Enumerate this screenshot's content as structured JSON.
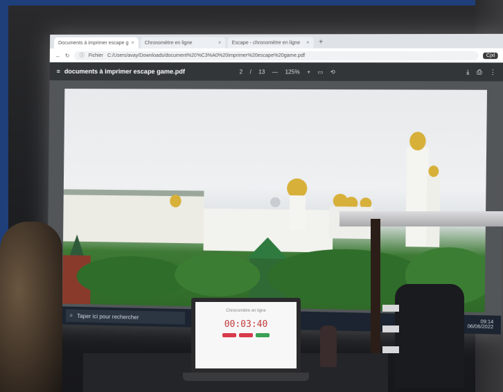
{
  "browser": {
    "tabs": [
      {
        "label": "Documents à imprimer escape g",
        "active": true
      },
      {
        "label": "Chronomètre en ligne",
        "active": false
      },
      {
        "label": "Escape - chronomètre en ligne",
        "active": false
      }
    ],
    "new_tab": "+",
    "address": "C:/Users/avay/Downloads/document%20%C3%A0%20imprimer%20escape%20game.pdf",
    "address_prefix": "Fichier",
    "badge": "Cjxl"
  },
  "pdf_viewer": {
    "title": "documents à imprimer escape game.pdf",
    "page_current": "2",
    "page_separator": "/",
    "page_total": "13",
    "zoom": "125%",
    "zoom_out": "—",
    "zoom_in": "+"
  },
  "taskbar": {
    "search_placeholder": "Taper ici pour rechercher",
    "time": "09:14",
    "date": "06/06/2022"
  },
  "laptop": {
    "title": "Chronomètre en ligne",
    "timer": "00:03:40",
    "button_colors": [
      "#d93a4a",
      "#d93a4a",
      "#3aa053"
    ]
  },
  "icons": [
    "back-arrow-icon",
    "reload-icon",
    "info-icon",
    "menu-icon",
    "fit-page-icon",
    "rotate-icon",
    "download-icon",
    "print-icon",
    "more-icon",
    "windows-icon",
    "search-icon"
  ]
}
